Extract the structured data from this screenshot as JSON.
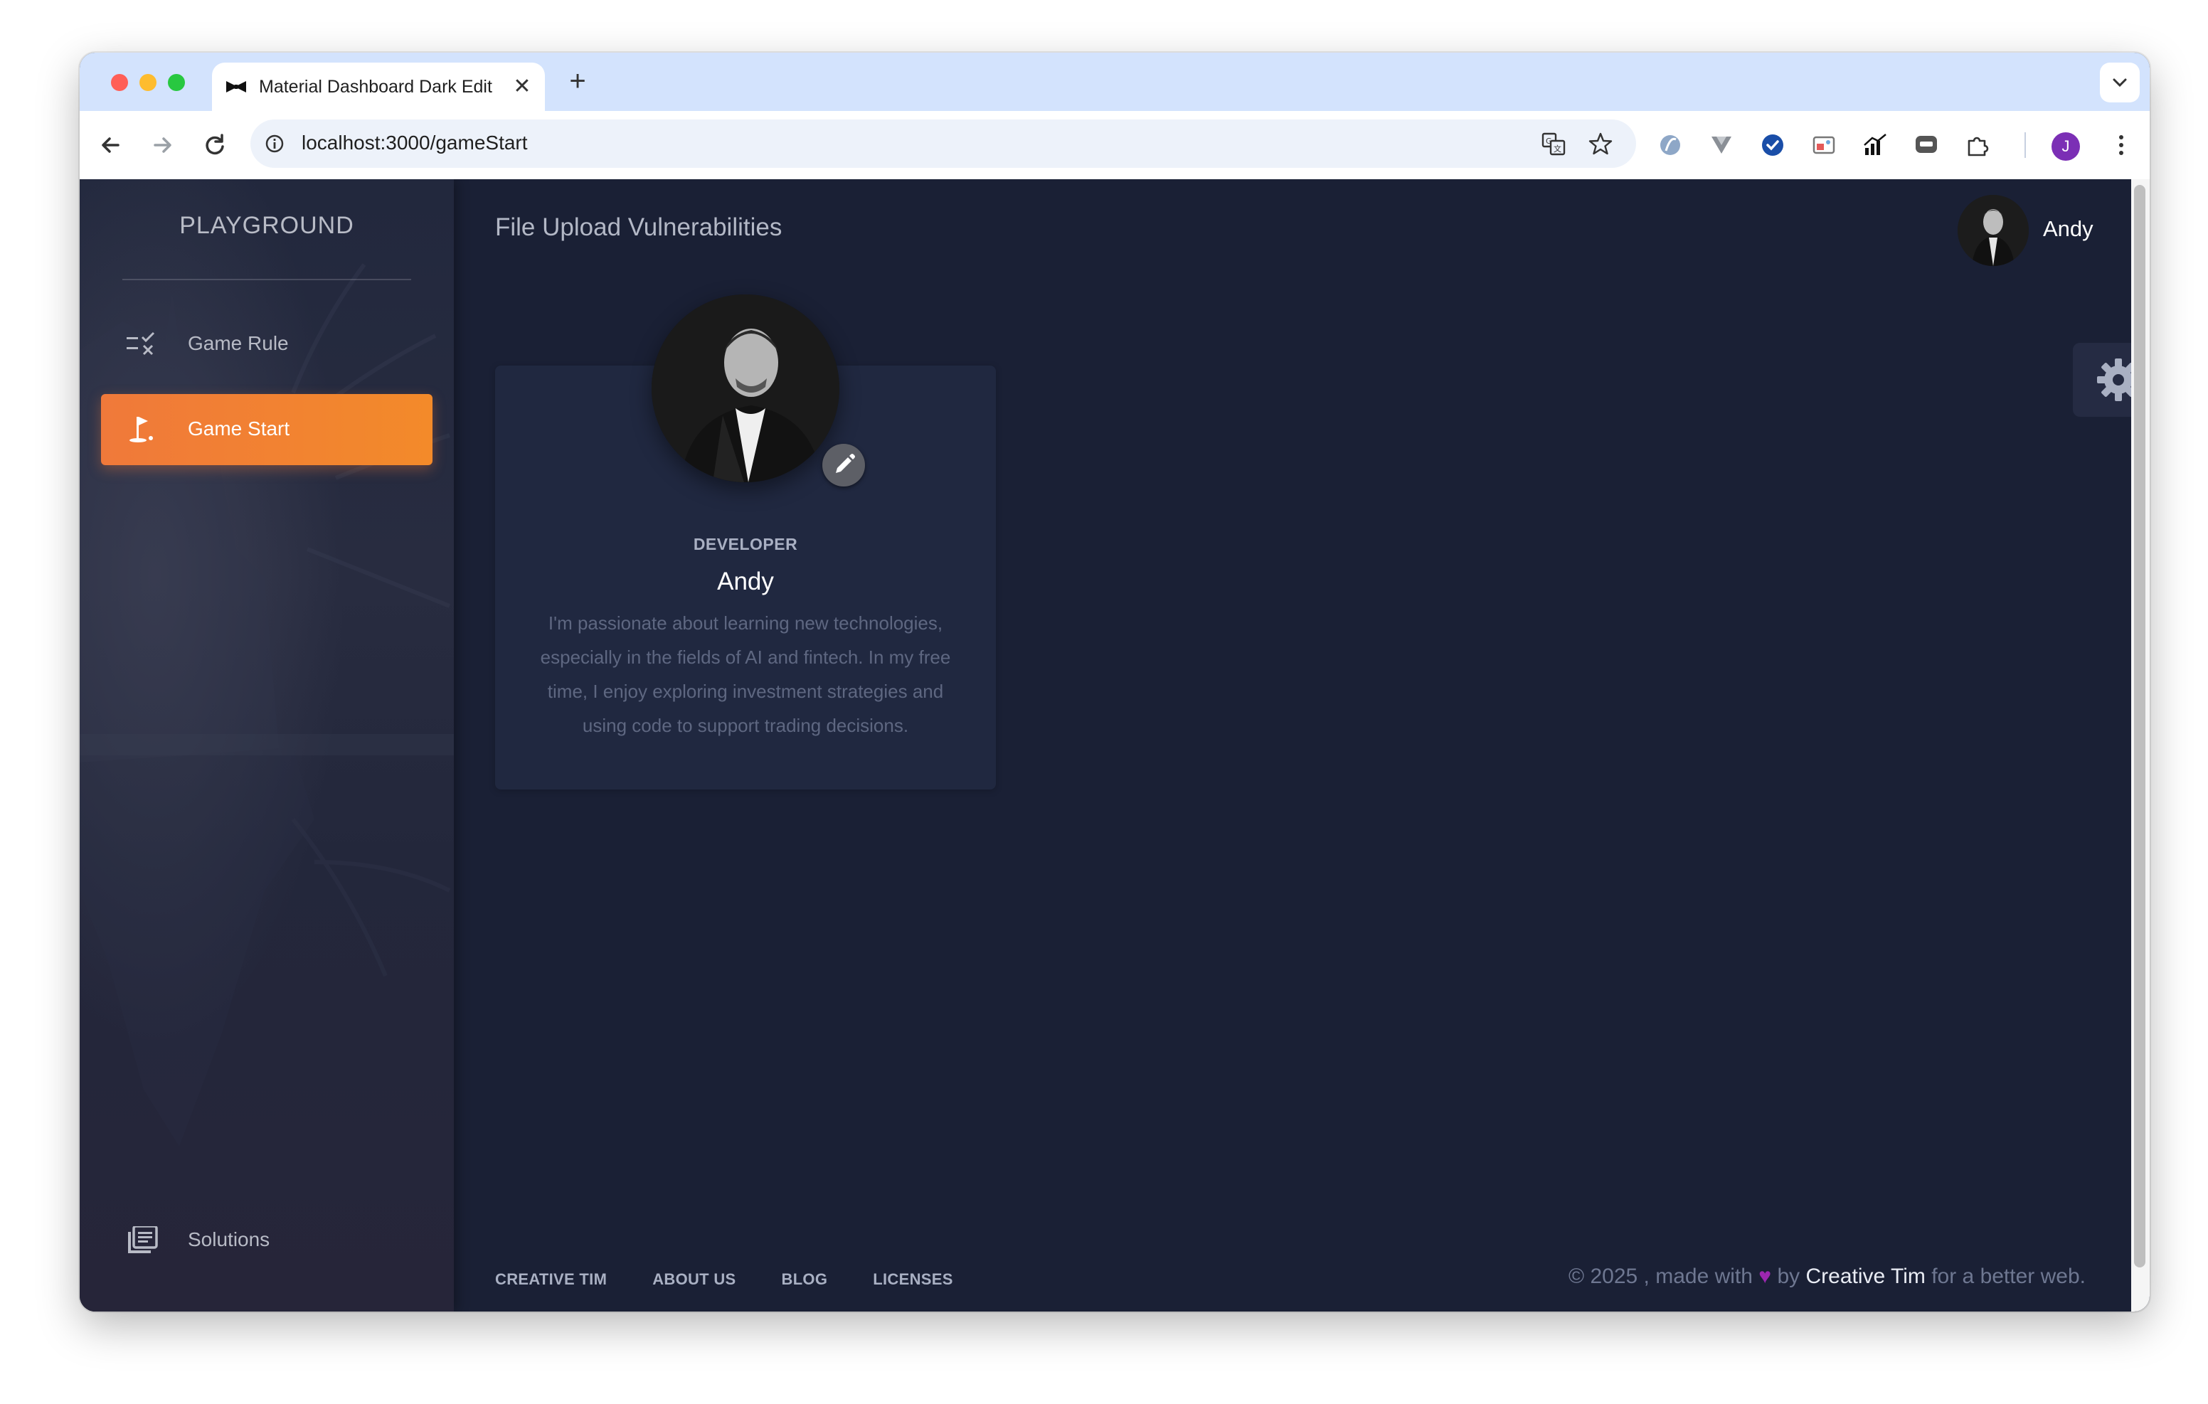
{
  "browser": {
    "tab_title": "Material Dashboard Dark Edit",
    "url": "localhost:3000/gameStart",
    "profile_initial": "J"
  },
  "sidebar": {
    "brand": "PLAYGROUND",
    "items": [
      {
        "label": "Game Rule",
        "icon": "checklist-icon",
        "active": false
      },
      {
        "label": "Game Start",
        "icon": "golf-flag-icon",
        "active": true
      },
      {
        "label": "Solutions",
        "icon": "library-books-icon",
        "active": false
      }
    ]
  },
  "header": {
    "title": "File Upload Vulnerabilities",
    "user_name": "Andy"
  },
  "profile_card": {
    "role": "DEVELOPER",
    "name": "Andy",
    "bio": "I'm passionate about learning new technologies, especially in the fields of AI and fintech. In my free time, I enjoy exploring investment strategies and using code to support trading decisions."
  },
  "footer": {
    "links": [
      "CREATIVE TIM",
      "ABOUT US",
      "BLOG",
      "LICENSES"
    ],
    "copyright_prefix": "© 2025 , made with",
    "copyright_by": "by",
    "copyright_brand": "Creative Tim",
    "copyright_suffix": "for a better web."
  },
  "colors": {
    "accent": "#f0793a",
    "page_bg": "#1a2035",
    "card_bg": "#202840",
    "heart": "#9c27b0"
  }
}
